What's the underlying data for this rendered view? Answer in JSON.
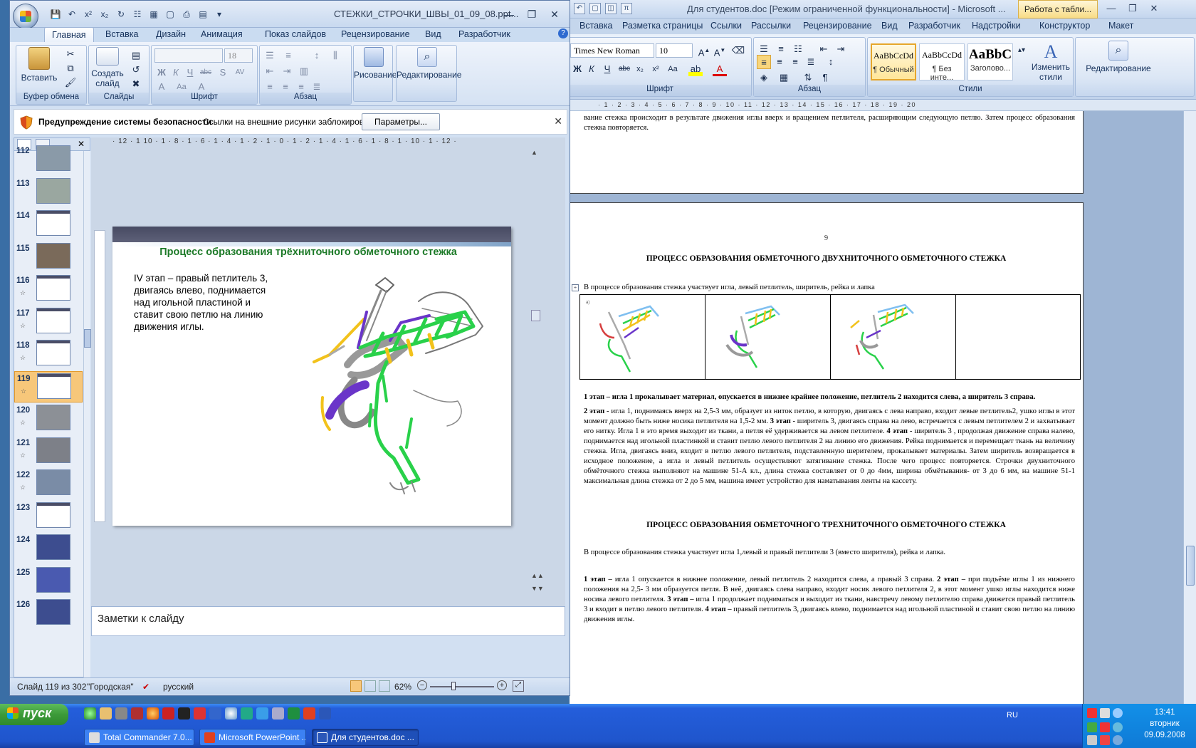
{
  "word": {
    "title": "Для студентов.doc [Режим ограниченной функциональности] - Microsoft ...",
    "context_tab": "Работа с табли...",
    "tabs": [
      "Вставка",
      "Разметка страницы",
      "Ссылки",
      "Рассылки",
      "Рецензирование",
      "Вид",
      "Разработчик",
      "Надстройки",
      "Конструктор",
      "Макет"
    ],
    "font_name": "Times New Roman",
    "font_size": "10",
    "styles": [
      {
        "preview": "AaBbCcDd",
        "label": "¶ Обычный"
      },
      {
        "preview": "AaBbCcDd",
        "label": "¶ Без инте..."
      },
      {
        "preview": "AaBbC",
        "label": "Заголово..."
      }
    ],
    "change_styles": "Изменить стили",
    "editing": "Редактирование",
    "groups": {
      "font": "Шрифт",
      "paragraph": "Абзац",
      "styles": "Стили"
    },
    "ruler": "· 1 · 2 · 3 · 4 · 5 · 6 · 7 · 8 · 9 · 10 · 11 · 12 · 13 · 14 · 15 · 16 · 17 · 18 · 19 · 20",
    "doc": {
      "top_text": "вание стежка происходит в результате движения иглы вверх и вращением петлителя, расширяющим следующую петлю. Затем процесс образования стежка повторяется.",
      "page_number": "9",
      "heading1": "ПРОЦЕСС ОБРАЗОВАНИЯ ОБМЕТОЧНОГО ДВУХНИТОЧНОГО ОБМЕТОЧНОГО СТЕЖКА",
      "intro1": "В процессе образования стежка участвует игла, левый петлитель, ширитель, рейка и лапка",
      "para1": "1 этап – игла 1 прокалывает материал, опускается в нижнее крайнее положение, петлитель 2 находится слева, а ширитель 3 справа.",
      "para2_b1": "2 этап",
      "para2": " - игла 1, поднимаясь вверх на 2,5-3 мм, образует из ниток петлю, в которую, двигаясь с лева направо, входит левые петлитель2, ушко иглы в этот момент должно быть ниже носика петлителя на 1,5-2 мм. ",
      "para2_b2": "3 этап",
      "para2b": " - ширитель 3, двигаясь справа на лево, встречается с левым петлителем 2 и захватывает его нитку. Игла 1 в это время выходит из ткани, а петля её удерживается на левом петлителе. ",
      "para2_b3": "4 этап",
      "para2c": " - ширитель 3 , продолжая движение справа налево, поднимается над игольной пластинкой и ставит петлю левого петлителя 2 на линию его движения. Рейка поднимается и перемещает ткань на величину стежка. Игла, двигаясь вниз, входит в петлю левого петлителя, подставленную шерителем, прокалывает материалы. Затем ширитель возвращается в исходное положение, а игла и левый петлитель осуществляют затягивание стежка. После чего процесс повторяется. Строчки двухниточного обмёточного стежка выполняют на машине 51-А кл., длина стежка составляет от 0 до 4мм, ширина обмётывания- от 3 до 6 мм, на машине 51-1 максимальная длина стежка от 2 до 5 мм, машина имеет устройство для наматывания ленты на кассету.",
      "heading2": "ПРОЦЕСС ОБРАЗОВАНИЯ ОБМЕТОЧНОГО ТРЕХНИТОЧНОГО ОБМЕТОЧНОГО СТЕЖКА",
      "intro2": "В процессе образования стежка участвует игла 1,левый и правый петлители 3 (вместо ширителя), рейка и лапка.",
      "para3_b1": "1 этап –",
      "para3": " игла 1 опускается в нижнее положение, левый петлитель 2 находится слева, а правый 3 справа. ",
      "para3_b2": "2 этап –",
      "para3b": " при подъёме иглы 1 из нижнего положения на 2,5- 3 мм образуется петля. В неё, двигаясь слева направо, входит носик левого петлителя 2, в этот момент ушко иглы находится ниже носика левого петлителя. ",
      "para3_b3": "3 этап –",
      "para3c": " игла 1 продолжает подниматься и выходит из ткани, навстречу левому петлителю справа движется правый петлитель 3 и входит в петлю левого петлителя. ",
      "para3_b4": "4 этап –",
      "para3d": " правый петлитель 3, двигаясь влево, поднимается над игольной пластиной и ставит свою петлю на линию движения иглы."
    }
  },
  "ppt": {
    "title": "СТЕЖКИ_СТРОЧКИ_ШВЫ_01_09_08.ppt...",
    "tabs": [
      "Главная",
      "Вставка",
      "Дизайн",
      "Анимация",
      "Показ слайдов",
      "Рецензирование",
      "Вид",
      "Разработчик"
    ],
    "groups": {
      "clipboard": "Буфер обмена",
      "paste": "Вставить",
      "slides": "Слайды",
      "new_slide": "Создать слайд",
      "font": "Шрифт",
      "font_size": "18",
      "paragraph": "Абзац",
      "drawing": "Рисование",
      "editing": "Редактирование"
    },
    "security": {
      "title": "Предупреждение системы безопасности",
      "message": "Ссылки на внешние рисунки заблокированы",
      "button": "Параметры..."
    },
    "ruler": "· 12 · 1 10 · 1 · 8 · 1 · 6 · 1 · 4 · 1 · 2 · 1 · 0 · 1 · 2 · 1 · 4 · 1 · 6 · 1 · 8 · 1 · 10 · 1 · 12 ·",
    "slides": [
      "112",
      "113",
      "114",
      "115",
      "116",
      "117",
      "118",
      "119",
      "120",
      "121",
      "122",
      "123",
      "124",
      "125",
      "126"
    ],
    "slide": {
      "title": "Процесс образования трёхниточного  обметочного  стежка",
      "body": "IV этап – правый  петлитель 3, двигаясь влево, поднимается над игольной пластиной и ставит свою петлю на линию движения иглы."
    },
    "notes": "Заметки к слайду",
    "status": {
      "slide": "Слайд 119 из 302",
      "theme": "\"Городская\"",
      "lang": "русский",
      "zoom": "62%"
    }
  },
  "taskbar": {
    "start": "пуск",
    "tasks": [
      "Total Commander 7.0...",
      "Microsoft PowerPoint ...",
      "Для студентов.doc ..."
    ],
    "lang": "RU",
    "time": "13:41",
    "day": "вторник",
    "date": "09.09.2008"
  },
  "colors": {
    "stitch_green": "#29d14a",
    "stitch_yellow": "#f2c21b",
    "stitch_purple": "#6a35c9",
    "slide_title": "#1d7a28"
  }
}
